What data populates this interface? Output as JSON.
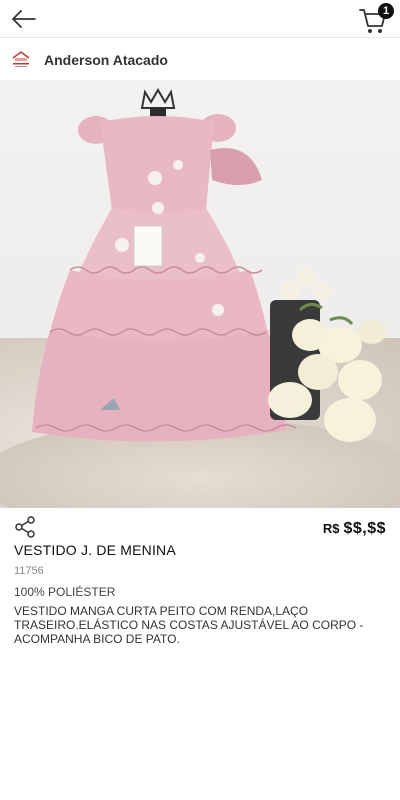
{
  "cart": {
    "count": "1"
  },
  "store": {
    "name": "Anderson Atacado"
  },
  "gallery": {
    "dots": 3,
    "active_index": 0
  },
  "product": {
    "currency": "R$",
    "price": "$$,$$",
    "title": "VESTIDO J. DE MENINA",
    "code": "11756",
    "material": "100% POLIÉSTER",
    "description": "VESTIDO MANGA CURTA PEITO COM RENDA,LAÇO TRASEIRO.ELÁSTICO NAS COSTAS AJUSTÁVEL AO CORPO -ACOMPANHA BICO DE PATO."
  },
  "icons": {
    "back": "arrow-left-icon",
    "cart": "shopping-cart-icon",
    "share": "share-icon",
    "logo": "store-logo-icon"
  },
  "colors": {
    "dress": "#e8b9c4",
    "dress_shade": "#d89fae",
    "flowers": "#f6f2dc",
    "badge": "#111111"
  }
}
